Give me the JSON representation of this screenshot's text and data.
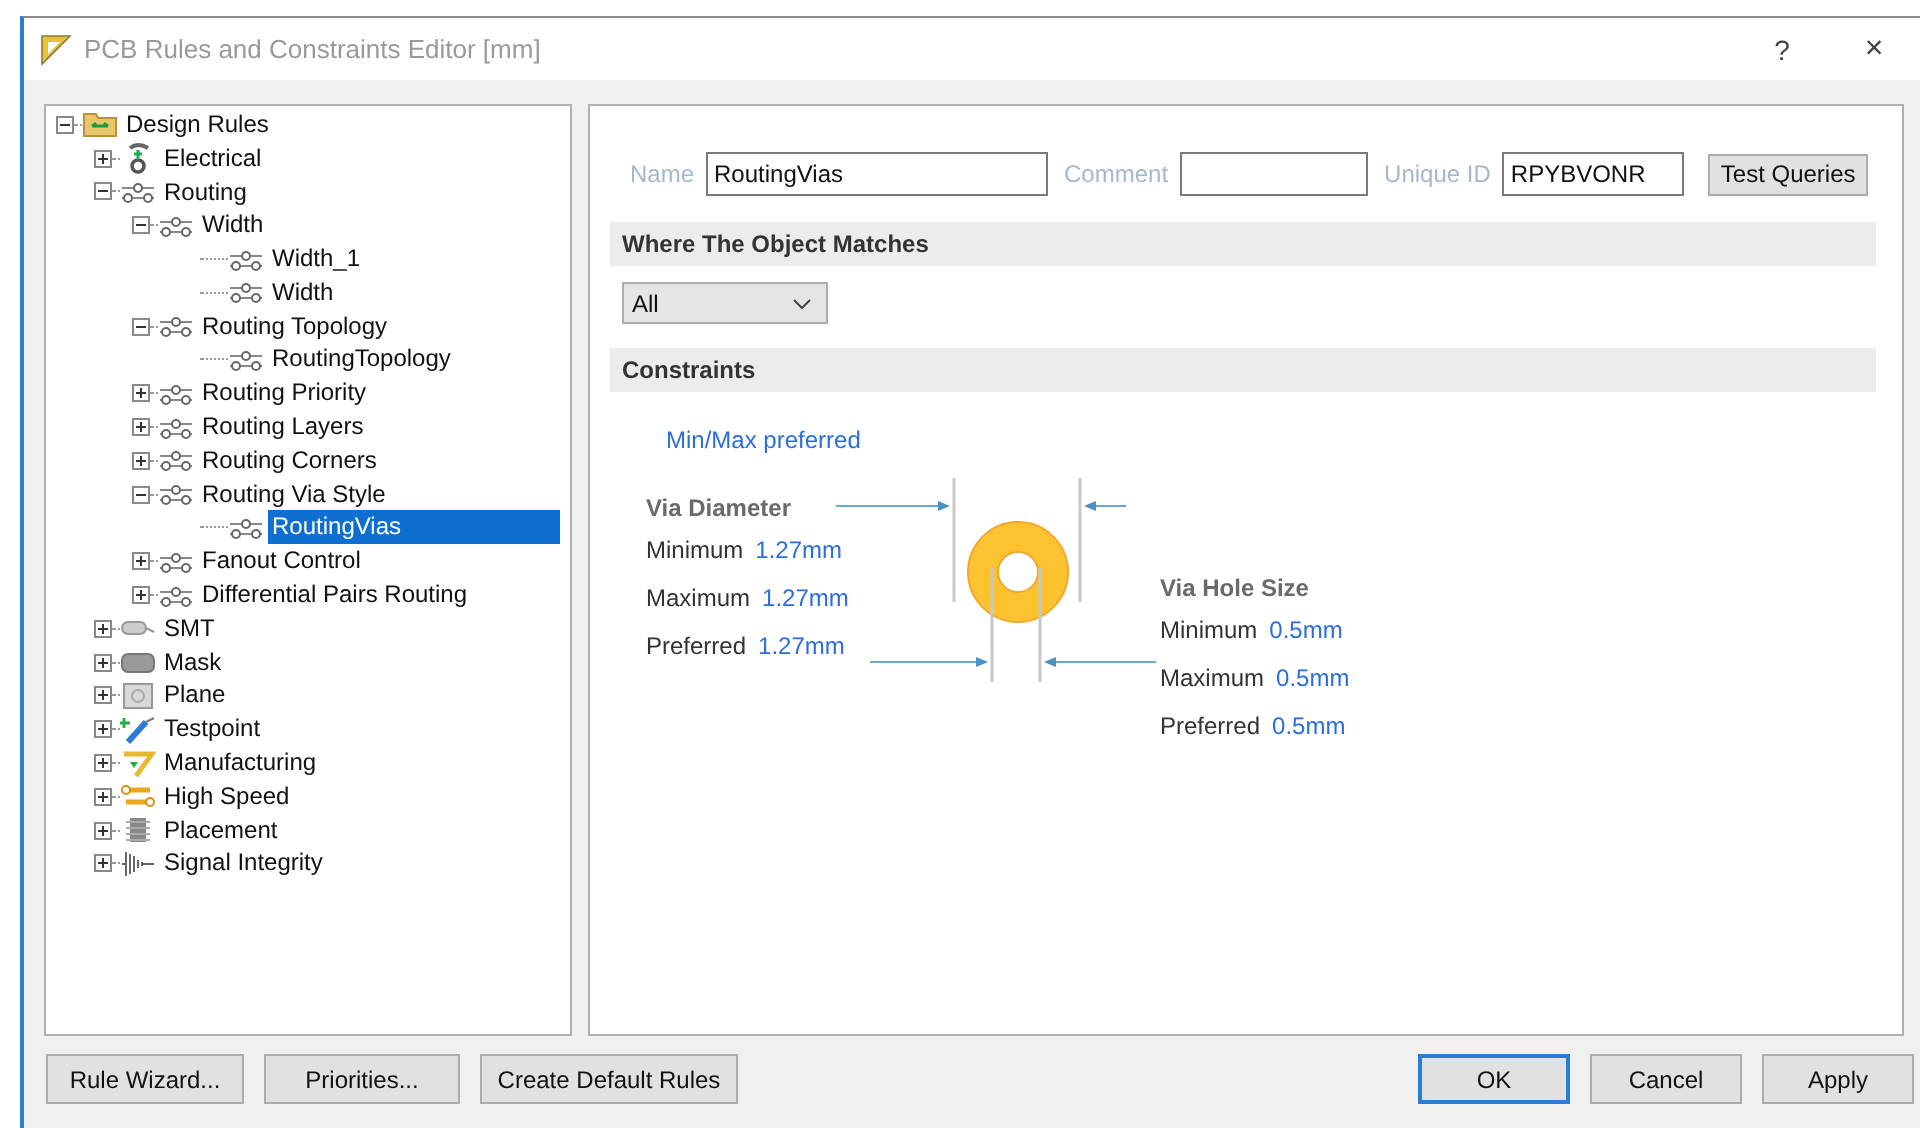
{
  "window": {
    "title": "PCB Rules and Constraints Editor [mm]",
    "help": "?",
    "close": "×"
  },
  "tree": [
    {
      "label": "Design Rules",
      "kind": "folder",
      "expanded": true,
      "selected": false,
      "children": [
        {
          "label": "Electrical",
          "kind": "electrical",
          "expanded": false,
          "selected": false
        },
        {
          "label": "Routing",
          "kind": "rule",
          "expanded": true,
          "selected": false,
          "children": [
            {
              "label": "Width",
              "kind": "rule",
              "expanded": true,
              "selected": false,
              "children": [
                {
                  "label": "Width_1",
                  "kind": "rule",
                  "selected": false
                },
                {
                  "label": "Width",
                  "kind": "rule",
                  "selected": false
                }
              ]
            },
            {
              "label": "Routing Topology",
              "kind": "rule",
              "expanded": true,
              "selected": false,
              "children": [
                {
                  "label": "RoutingTopology",
                  "kind": "rule",
                  "selected": false
                }
              ]
            },
            {
              "label": "Routing Priority",
              "kind": "rule",
              "expanded": false,
              "selected": false
            },
            {
              "label": "Routing Layers",
              "kind": "rule",
              "expanded": false,
              "selected": false
            },
            {
              "label": "Routing Corners",
              "kind": "rule",
              "expanded": false,
              "selected": false
            },
            {
              "label": "Routing Via Style",
              "kind": "rule",
              "expanded": true,
              "selected": false,
              "children": [
                {
                  "label": "RoutingVias",
                  "kind": "rule",
                  "selected": true
                }
              ]
            },
            {
              "label": "Fanout Control",
              "kind": "rule",
              "expanded": false,
              "selected": false
            },
            {
              "label": "Differential Pairs Routing",
              "kind": "rule",
              "expanded": false,
              "selected": false
            }
          ]
        },
        {
          "label": "SMT",
          "kind": "smt",
          "expanded": false,
          "selected": false
        },
        {
          "label": "Mask",
          "kind": "mask",
          "expanded": false,
          "selected": false
        },
        {
          "label": "Plane",
          "kind": "plane",
          "expanded": false,
          "selected": false
        },
        {
          "label": "Testpoint",
          "kind": "testpoint",
          "expanded": false,
          "selected": false
        },
        {
          "label": "Manufacturing",
          "kind": "manufacturing",
          "expanded": false,
          "selected": false
        },
        {
          "label": "High Speed",
          "kind": "highspeed",
          "expanded": false,
          "selected": false
        },
        {
          "label": "Placement",
          "kind": "placement",
          "expanded": false,
          "selected": false
        },
        {
          "label": "Signal Integrity",
          "kind": "signal",
          "expanded": false,
          "selected": false
        }
      ]
    }
  ],
  "rule": {
    "name_label": "Name",
    "name": "RoutingVias",
    "comment_label": "Comment",
    "uid_label": "Unique ID",
    "uid": "RPYBVONR",
    "test_button": "Test Queries"
  },
  "where": {
    "title": "Where The Object Matches",
    "dropdown": "All"
  },
  "constraints": {
    "title": "Constraints",
    "mode": "Min/Max preferred",
    "diameter": {
      "title": "Via Diameter",
      "rows": [
        {
          "label": "Minimum",
          "value": "1.27mm"
        },
        {
          "label": "Maximum",
          "value": "1.27mm"
        },
        {
          "label": "Preferred",
          "value": "1.27mm"
        }
      ]
    },
    "hole": {
      "title": "Via Hole Size",
      "rows": [
        {
          "label": "Minimum",
          "value": "0.5mm"
        },
        {
          "label": "Maximum",
          "value": "0.5mm"
        },
        {
          "label": "Preferred",
          "value": "0.5mm"
        }
      ]
    }
  },
  "buttons_left": [
    "Rule Wizard...",
    "Priorities...",
    "Create Default Rules"
  ],
  "buttons_right": [
    {
      "label": "OK",
      "default": true
    },
    {
      "label": "Cancel",
      "default": false
    },
    {
      "label": "Apply",
      "default": false
    }
  ]
}
